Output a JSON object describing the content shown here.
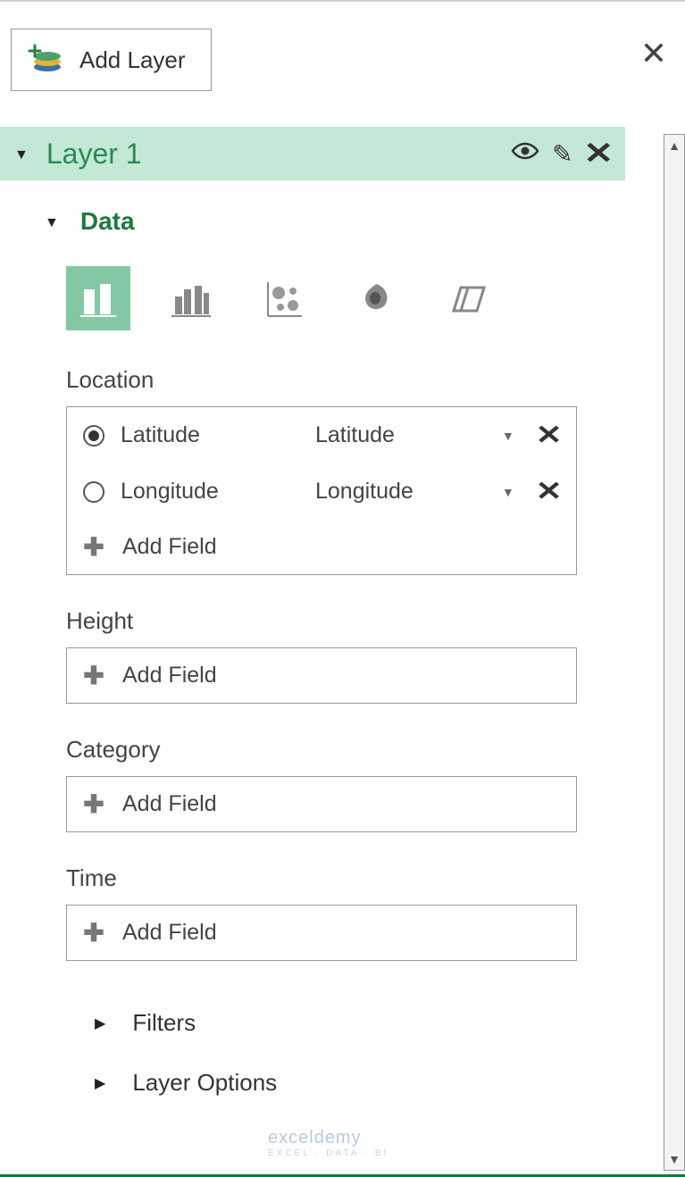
{
  "buttons": {
    "add_layer": "Add Layer"
  },
  "layer": {
    "title": "Layer 1"
  },
  "data_section": {
    "label": "Data",
    "viz_types": [
      "stacked-column",
      "clustered-column",
      "bubble",
      "heatmap",
      "region"
    ],
    "selected_viz": 0
  },
  "sections": {
    "location": {
      "label": "Location",
      "fields": [
        {
          "name": "Latitude",
          "type": "Latitude",
          "selected": true
        },
        {
          "name": "Longitude",
          "type": "Longitude",
          "selected": false
        }
      ],
      "add_label": "Add Field"
    },
    "height": {
      "label": "Height",
      "add_label": "Add Field"
    },
    "category": {
      "label": "Category",
      "add_label": "Add Field"
    },
    "time": {
      "label": "Time",
      "add_label": "Add Field"
    }
  },
  "collapsed": {
    "filters": "Filters",
    "layer_options": "Layer Options"
  },
  "watermark": {
    "brand": "exceldemy",
    "tagline": "EXCEL · DATA · BI"
  }
}
